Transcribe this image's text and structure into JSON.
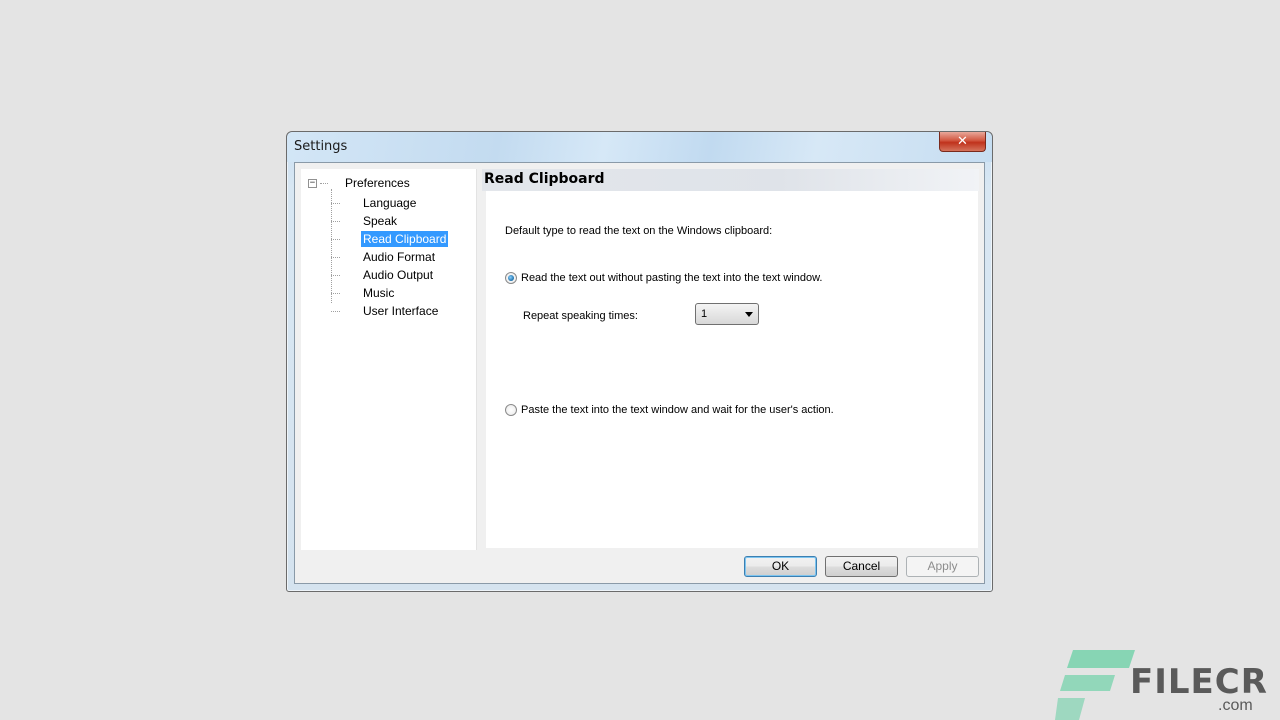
{
  "window": {
    "title": "Settings",
    "close_glyph": "✕"
  },
  "tree": {
    "root": {
      "expander": "−",
      "label": "Preferences"
    },
    "items": [
      {
        "label": "Language"
      },
      {
        "label": "Speak"
      },
      {
        "label": "Read Clipboard",
        "selected": true
      },
      {
        "label": "Audio Format"
      },
      {
        "label": "Audio Output"
      },
      {
        "label": "Music"
      },
      {
        "label": "User Interface"
      }
    ]
  },
  "panel": {
    "header": "Read Clipboard",
    "description": "Default type to read the text on the Windows clipboard:",
    "option_read": "Read the text out without pasting the text into the text window.",
    "option_read_checked": true,
    "repeat_label": "Repeat speaking times:",
    "repeat_value": "1",
    "option_paste": "Paste the text into the text window and wait for the user's action.",
    "option_paste_checked": false
  },
  "buttons": {
    "ok": "OK",
    "cancel": "Cancel",
    "apply": "Apply"
  },
  "watermark": {
    "text": "FILECR",
    "sub": ".com",
    "colors": {
      "mark": "#6fd1a8",
      "text": "#5a5a5a"
    }
  }
}
